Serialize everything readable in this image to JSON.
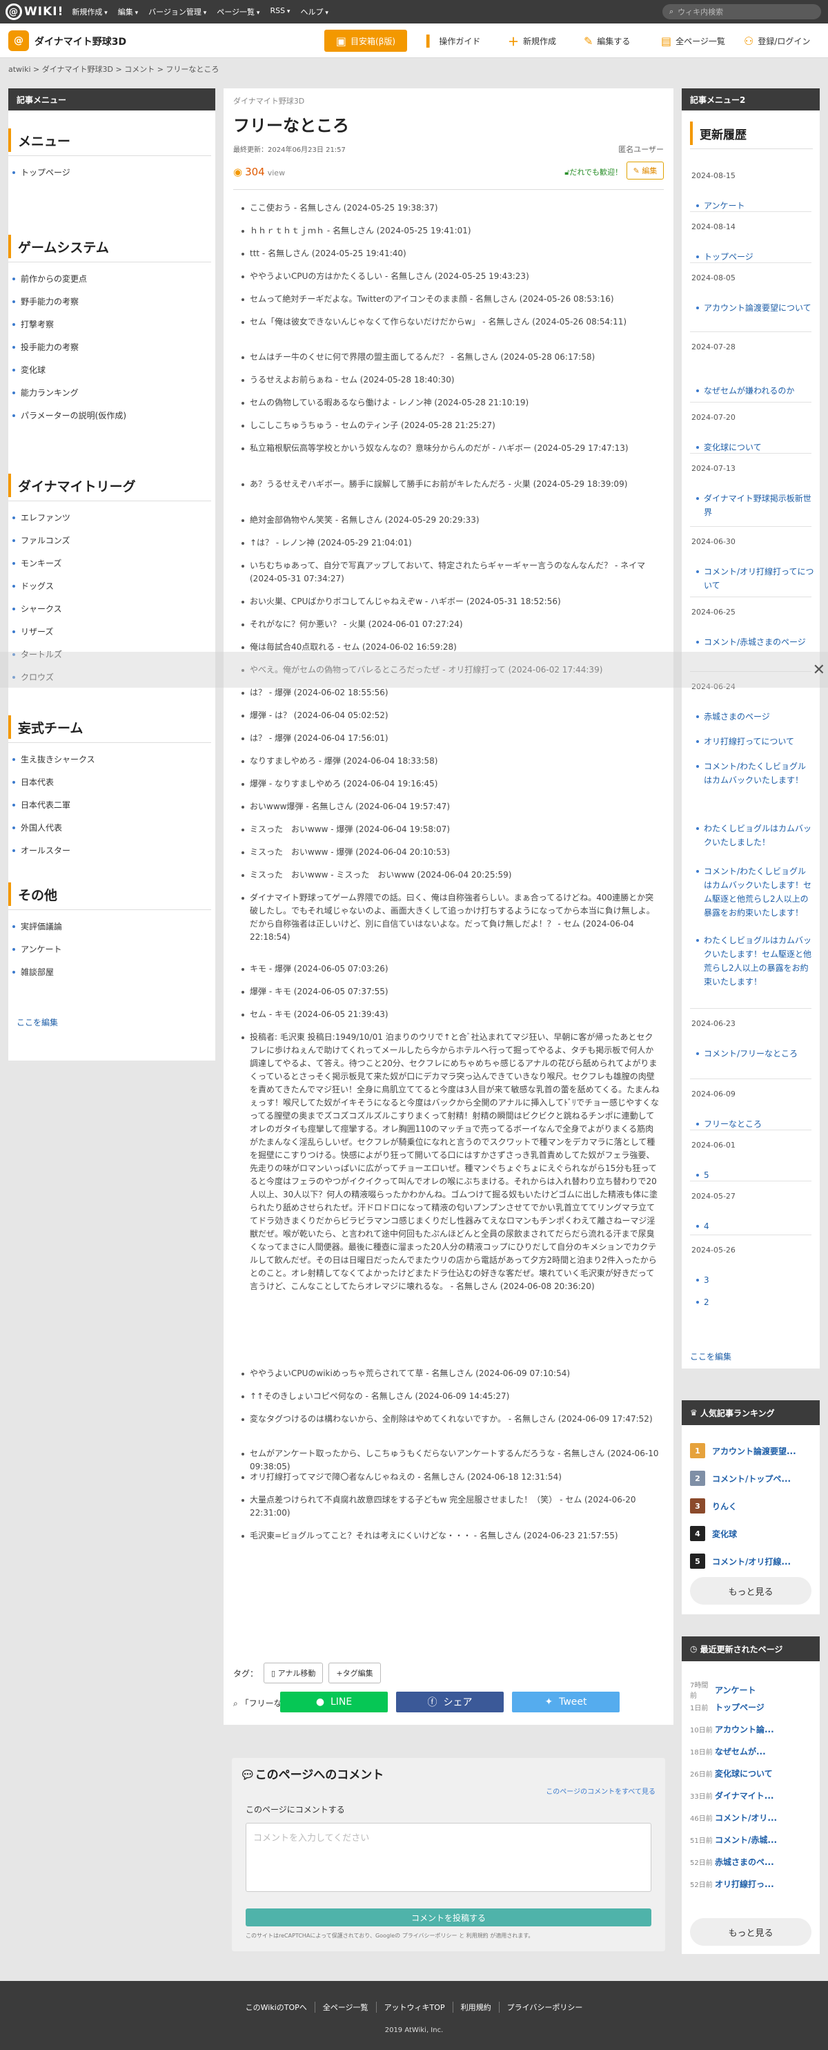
{
  "topbar": {
    "logo": "WIKI!",
    "logo_at": "@",
    "menus": [
      "新規作成",
      "編集",
      "バージョン管理",
      "ページ一覧",
      "RSS",
      "ヘルプ"
    ],
    "search_placeholder": "ウィキ内検索"
  },
  "header": {
    "site_icon": "@",
    "site_name": "ダイナマイト野球3D",
    "bookmark": "目安箱(β版)",
    "buttons": [
      "操作ガイド",
      "新規作成",
      "編集する",
      "全ページ一覧",
      "登録/ログイン"
    ]
  },
  "breadcrumb": "atwiki > ダイナマイト野球3D > コメント > フリーなところ",
  "left_menu": {
    "title": "記事メニュー",
    "sections": [
      {
        "heading": "メニュー",
        "items": [
          "トップページ"
        ]
      },
      {
        "heading": "ゲームシステム",
        "items": [
          "前作からの変更点",
          "野手能力の考察",
          "打撃考察",
          "投手能力の考察",
          "変化球",
          "能力ランキング",
          "パラメーターの説明(仮作成)"
        ]
      },
      {
        "heading": "ダイナマイトリーグ",
        "items": [
          "エレファンツ",
          "ファルコンズ",
          "モンキーズ",
          "ドッグス",
          "シャークス",
          "リザーズ",
          "タートルズ",
          "クロウズ"
        ]
      },
      {
        "heading": "妄式チーム",
        "items": [
          "生え抜きシャークス",
          "日本代表",
          "日本代表二軍",
          "外国人代表",
          "オールスター"
        ]
      },
      {
        "heading": "その他",
        "items": [
          "実評価議論",
          "アンケート",
          "雑談部屋"
        ]
      }
    ],
    "edit_link": "ここを編集"
  },
  "page": {
    "category": "ダイナマイト野球3D",
    "title": "フリーなところ",
    "updated": "最終更新：2024年06月23日 21:57",
    "author": "匿名ユーザー",
    "views": "304",
    "views_unit": "view",
    "welcome": "だれでも歓迎！",
    "edit": "編集",
    "comments": [
      "ここ使おう - 名無しさん (2024-05-25 19:38:37)",
      "ｈｈｒｔｈｔｊｍｈ - 名無しさん (2024-05-25 19:41:01)",
      "ttt - 名無しさん (2024-05-25 19:41:40)",
      "ややうよいCPUの方はかたくるしい - 名無しさん (2024-05-25 19:43:23)",
      "セムって絶対チーギだよな。Twitterのアイコンそのまま顔 - 名無しさん (2024-05-26 08:53:16)",
      "セム「俺は彼女できないんじゃなくて作らないだけだからw」 - 名無しさん (2024-05-26 08:54:11)",
      "セムはチー牛のくせに何で界隈の盟主面してるんだ？ - 名無しさん (2024-05-28 06:17:58)",
      "うるせえよお前らぁね - セム (2024-05-28 18:40:30)",
      "セムの偽物している暇あるなら働けよ - レノン神 (2024-05-28 21:10:19)",
      "しこしこちゅうちゅう - セムのティン子 (2024-05-28 21:25:27)",
      "私立箱根駅伝高等学校とかいう奴なんなの？意味分からんのだが - ハギボー (2024-05-29 17:47:13)",
      "あ？うるせえぞハギボー。勝手に誤解して勝手にお前がキレたんだろ - 火巣 (2024-05-29 18:39:09)",
      "絶対金部偽物やん笑笑 - 名無しさん (2024-05-29 20:29:33)",
      "↑は？ - レノン神 (2024-05-29 21:04:01)",
      "いちむちゅあって、自分で写真アップしておいて、特定されたらギャーギャー言うのなんなんだ？ - ネイマ (2024-05-31 07:34:27)",
      "おい火巣、CPUばかりボコしてんじゃねえぞw - ハギボー (2024-05-31 18:52:56)",
      "それがなに？何か悪い？ - 火巣 (2024-06-01 07:27:24)",
      "俺は毎試合40点取れる - セム (2024-06-02 16:59:28)",
      "やべえ。俺がセムの偽物ってバレるところだったぜ - オリ打線打って (2024-06-02 17:44:39)",
      "は？ - 爆弾 (2024-06-02 18:55:56)",
      "爆弾 - は？ (2024-06-04 05:02:52)",
      "は？ - 爆弾 (2024-06-04 17:56:01)",
      "なりすましやめろ - 爆弾 (2024-06-04 18:33:58)",
      "爆弾 - なりすましやめろ (2024-06-04 19:16:45)",
      "おいwww爆弾 - 名無しさん (2024-06-04 19:57:47)",
      "ミスった　おいwww - 爆弾 (2024-06-04 19:58:07)",
      "ミスった　おいwww - 爆弾 (2024-06-04 20:10:53)",
      "ミスった　おいwww - ミスった　おいwww (2024-06-04 20:25:59)",
      "ダイナマイト野球ってゲーム界隈での話。曰く、俺は自称強者らしい。まぁ合ってるけどね。400連勝とか突破したし。でもそれ域じゃないのよ、画面大きくして追っかけ打ちするようになってから本当に負け無しよ。だから自称強者は正しいけど、別に自信ていはないよな。だって負け無しだよ！？ - セム (2024-06-04 22:18:54)",
      "キモ - 爆弾 (2024-06-05 07:03:26)",
      "爆弾 - キモ (2024-06-05 07:37:55)",
      "セム - キモ (2024-06-05 21:39:43)",
      "投稿者: 毛沢東 投稿日:1949/10/01 泊まりのウリで↑と合ﾞ社込まれてマジ狂い、早朝に客が帰ったあとセクフレに歩けねぇんで助けてくれってメールしたら今からホテルへ行って掘ってやるよ、タチも掲示板で何人か調達してやるよ、て答え。待つこと20分、セクフレにめちゃめちゃ感じるアナルの花びら舐められてよがりまくっているとさっそく掲示板見て来た奴が口にデカマラ突っ込んできていきなり喉尺。セクフレも雄膣の肉壁を責めてきたんでマジ狂い！全身に鳥肌立ててると今度は3人目が来て敏感な乳首の蕾を舐めてくる。たまんねぇっす！喉尺してた奴がイキそうになると今度はバックから全開のアナルに挿入してﾄﾞﾘでチョー感じやすくなってる膣壁の奥までズコズコズルズルこすりまくって射精！射精の瞬間はビクビクと跳ねるチンポに連動してオレのガタイも痙攣して痙攣する。オレ胸囲110のマッチョで売ってるボーイなんで全身でよがりまくる筋肉がたまんなく淫乱らしいぜ。セクフレが騎乗位になれと言うのでスクワットで種マンをデカマラに落として種を掘壁にこすりつける。快感によがり狂って開いてる口にはすかさずさっき乳首責めしてた奴がフェラ強要、先走りの味がロマンいっぱいに広がってチョーエロいぜ。種マンぐちょぐちょにえぐられながら15分も狂ってると今度はフェラのやつがイクイクって叫んでオレの喉にぶちまける。それからは入れ替わり立ち替わりで20人以上、30人以下？何人の精液啜らったかわかんね。ゴムつけて掘る奴もいたけどゴムに出した精液も体に塗られたり舐めさせられたぜ。汗ドロドロになって精液の匂いプンプンさせてでかい乳首立ててリングマラ立ててドラ効きまくりだからビラビラマンコ感じまくりだし性器みてえなロマンもチンポくわえて離さねーマジ淫獣だぜ。喉が乾いたら、と言われて途中何回もたぷんほどんと全員の尿飲まされてだらだら流れる汗まで尿臭くなってまさに人間便器。最後に種壺に溜まった20人分の精液コップにひりだして自分のキメションでカクテルして飲んだぜ。その日は日曜日だったんでまたウリの店から電話があって夕方2時間と泊まり2件入ったからとのこと。オレ射精してなくてよかったけどまたドラ仕込むの好きな客だぜ。壊れていく毛沢東が好きだって言うけど、こんなことしてたらオレマジに壊れるな。 - 名無しさん (2024-06-08 20:36:20)",
      "ややうよいCPUのwikiめっちゃ荒らされてて草 - 名無しさん (2024-06-09 07:10:54)",
      "↑↑そのきしょいコピペ何なの - 名無しさん (2024-06-09 14:45:27)",
      "変なタグつけるのは構わないから、全削除はやめてくれないですか。 - 名無しさん (2024-06-09 17:47:52)",
      "セムがアンケート取ったから、しこちゅうもくだらないアンケートするんだろうな - 名無しさん (2024-06-10 09:38:05)",
      "オリ打線打ってマジで障〇者なんじゃねえの - 名無しさん (2024-06-18 12:31:54)",
      "大量点差つけられて不貞腐れ故意四球をする子どもw 完全屈服させました！（笑） - セム (2024-06-20 22:31:00)",
      "毛沢東=ビョグルってこと？それは考えにくいけどな・・・ - 名無しさん (2024-06-23 21:57:55)"
    ],
    "tag_label": "タグ：",
    "tag": "アナル移動",
    "tag_edit": "+タグ編集",
    "search_link": "「フリーなところ」をウィキ内検索"
  },
  "share": {
    "line": "LINE",
    "facebook": "シェア",
    "twitter": "Tweet"
  },
  "comment_form": {
    "title": "このページへのコメント",
    "view_all": "このページのコメントをすべて見る",
    "label": "このページにコメントする",
    "placeholder": "コメントを入力してください",
    "submit": "コメントを投稿する",
    "note": "このサイトはreCAPTCHAによって保護されており、Googleの プライバシーポリシー と 利用規約 が適用されます。"
  },
  "right_menu": {
    "title": "記事メニュー2",
    "heading": "更新履歴",
    "updates": [
      {
        "date": "2024-08-15",
        "items": [
          "アンケート"
        ]
      },
      {
        "date": "2024-08-14",
        "items": [
          "トップページ"
        ]
      },
      {
        "date": "2024-08-05",
        "items": [
          "アカウント論渡要望について"
        ]
      },
      {
        "date": "2024-07-28",
        "items": [
          "なぜセムが嫌われるのか"
        ]
      },
      {
        "date": "2024-07-20",
        "items": [
          "変化球について"
        ]
      },
      {
        "date": "2024-07-13",
        "items": [
          "ダイナマイト野球掲示板新世界"
        ]
      },
      {
        "date": "2024-06-30",
        "items": [
          "コメント/オリ打線打ってについて"
        ]
      },
      {
        "date": "2024-06-25",
        "items": [
          "コメント/赤城さまのページ"
        ]
      },
      {
        "date": "2024-06-24",
        "items": [
          "赤城さまのページ",
          "オリ打線打ってについて",
          "コメント/わたくしビョグルはカムバックいたします！",
          "わたくしビョグルはカムバックいたしました！",
          "コメント/わたくしビョグルはカムバックいたします！セム駆逐と他荒らし2人以上の暴露をお約束いたします！",
          "わたくしビョグルはカムバックいたします！セム駆逐と他荒らし2人以上の暴露をお約束いたします！"
        ]
      },
      {
        "date": "2024-06-23",
        "items": [
          "コメント/フリーなところ"
        ]
      },
      {
        "date": "2024-06-09",
        "items": [
          "フリーなところ"
        ]
      },
      {
        "date": "2024-06-01",
        "items": [
          "5"
        ]
      },
      {
        "date": "2024-05-27",
        "items": [
          "4"
        ]
      },
      {
        "date": "2024-05-26",
        "items": [
          "3",
          "2"
        ]
      }
    ],
    "edit_link": "ここを編集"
  },
  "ranking": {
    "title": "人気記事ランキング",
    "items": [
      "アカウント論渡要望...",
      "コメント/トップペ...",
      "りんく",
      "変化球",
      "コメント/オリ打線..."
    ],
    "colors": [
      "#e6a23c",
      "#7f8fa6",
      "#8b4a2b",
      "#222222",
      "#222222"
    ],
    "more": "もっと見る"
  },
  "recent": {
    "title": "最近更新されたページ",
    "items": [
      {
        "time": "7時間前",
        "title": "アンケート"
      },
      {
        "time": "1日前",
        "title": "トップページ"
      },
      {
        "time": "10日前",
        "title": "アカウント論..."
      },
      {
        "time": "18日前",
        "title": "なぜセムが..."
      },
      {
        "time": "26日前",
        "title": "変化球について"
      },
      {
        "time": "33日前",
        "title": "ダイナマイト..."
      },
      {
        "time": "46日前",
        "title": "コメント/オリ..."
      },
      {
        "time": "51日前",
        "title": "コメント/赤城..."
      },
      {
        "time": "52日前",
        "title": "赤城さまのペ..."
      },
      {
        "time": "52日前",
        "title": "オリ打線打っ..."
      }
    ],
    "more": "もっと見る"
  },
  "footer": {
    "links": [
      "このWikiのTOPへ",
      "全ページ一覧",
      "アットウィキTOP",
      "利用規約",
      "プライバシーポリシー"
    ],
    "copyright": "2019 AtWiki, Inc."
  }
}
